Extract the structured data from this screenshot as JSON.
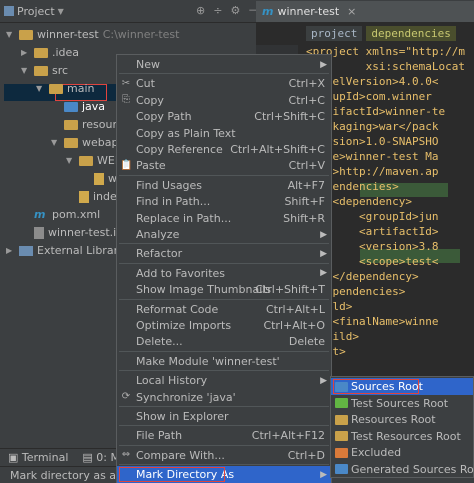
{
  "topbar": {
    "project_tab": "Project",
    "editor_tab": "winner-test"
  },
  "tree": [
    {
      "label": "winner-test",
      "extra": "C:\\winner-test",
      "indent": 0,
      "icon": "folder",
      "arrow": "▼"
    },
    {
      "label": ".idea",
      "extra": "",
      "indent": 1,
      "icon": "folder",
      "arrow": "▶"
    },
    {
      "label": "src",
      "extra": "",
      "indent": 1,
      "icon": "folder",
      "arrow": "▼"
    },
    {
      "label": "main",
      "extra": "",
      "indent": 2,
      "icon": "folder",
      "arrow": "▼"
    },
    {
      "label": "java",
      "extra": "",
      "indent": 3,
      "icon": "folder-blue",
      "arrow": ""
    },
    {
      "label": "resourc",
      "extra": "",
      "indent": 3,
      "icon": "folder",
      "arrow": ""
    },
    {
      "label": "webapp",
      "extra": "",
      "indent": 3,
      "icon": "folder-web",
      "arrow": "▼"
    },
    {
      "label": "WEB",
      "extra": "",
      "indent": 4,
      "icon": "folder",
      "arrow": "▼"
    },
    {
      "label": "w",
      "extra": "",
      "indent": 5,
      "icon": "file",
      "arrow": ""
    },
    {
      "label": "inde",
      "extra": "",
      "indent": 4,
      "icon": "file",
      "arrow": ""
    },
    {
      "label": "pom.xml",
      "extra": "",
      "indent": 1,
      "icon": "maven",
      "arrow": ""
    },
    {
      "label": "winner-test.iml",
      "extra": "",
      "indent": 1,
      "icon": "iml",
      "arrow": ""
    },
    {
      "label": "External Libraries",
      "extra": "",
      "indent": 0,
      "icon": "libs",
      "arrow": "▶"
    }
  ],
  "editor": {
    "breadcrumbs": [
      "project",
      "dependencies"
    ],
    "line_number": "1",
    "lines": [
      "<project xmlns=\"http://m",
      "         xsi:schemaLocat",
      "<modelVersion>4.0.0<",
      "<groupId>com.winner",
      "<artifactId>winner-te",
      "<packaging>war</pack",
      "<version>1.0-SNAPSHO",
      "<name>winner-test Ma",
      "<url>http://maven.ap",
      "<dependencies>",
      "    <dependency>",
      "        <groupId>jun",
      "        <artifactId>",
      "        <version>3.8",
      "        <scope>test<",
      "    </dependency>",
      "</dependencies>",
      "<build>",
      "    <finalName>winne",
      "</build>",
      "oject>"
    ]
  },
  "context_menu": [
    {
      "label": "New",
      "shortcut": "",
      "submenu": true,
      "icon": ""
    },
    {
      "sep": true
    },
    {
      "label": "Cut",
      "shortcut": "Ctrl+X",
      "icon": "scissors-icon"
    },
    {
      "label": "Copy",
      "shortcut": "Ctrl+C",
      "icon": "copy-icon"
    },
    {
      "label": "Copy Path",
      "shortcut": "Ctrl+Shift+C",
      "icon": ""
    },
    {
      "label": "Copy as Plain Text",
      "shortcut": "",
      "icon": ""
    },
    {
      "label": "Copy Reference",
      "shortcut": "Ctrl+Alt+Shift+C",
      "icon": ""
    },
    {
      "label": "Paste",
      "shortcut": "Ctrl+V",
      "icon": "paste-icon"
    },
    {
      "sep": true
    },
    {
      "label": "Find Usages",
      "shortcut": "Alt+F7",
      "icon": ""
    },
    {
      "label": "Find in Path...",
      "shortcut": "Shift+F",
      "icon": ""
    },
    {
      "label": "Replace in Path...",
      "shortcut": "Shift+R",
      "icon": ""
    },
    {
      "label": "Analyze",
      "shortcut": "",
      "submenu": true,
      "icon": ""
    },
    {
      "sep": true
    },
    {
      "label": "Refactor",
      "shortcut": "",
      "submenu": true,
      "icon": ""
    },
    {
      "sep": true
    },
    {
      "label": "Add to Favorites",
      "shortcut": "",
      "submenu": true,
      "icon": ""
    },
    {
      "label": "Show Image Thumbnails",
      "shortcut": "Ctrl+Shift+T",
      "icon": ""
    },
    {
      "sep": true
    },
    {
      "label": "Reformat Code",
      "shortcut": "Ctrl+Alt+L",
      "icon": ""
    },
    {
      "label": "Optimize Imports",
      "shortcut": "Ctrl+Alt+O",
      "icon": ""
    },
    {
      "label": "Delete...",
      "shortcut": "Delete",
      "icon": ""
    },
    {
      "sep": true
    },
    {
      "label": "Make Module 'winner-test'",
      "shortcut": "",
      "icon": ""
    },
    {
      "sep": true
    },
    {
      "label": "Local History",
      "shortcut": "",
      "submenu": true,
      "icon": ""
    },
    {
      "label": "Synchronize 'java'",
      "shortcut": "",
      "icon": "sync-icon"
    },
    {
      "sep": true
    },
    {
      "label": "Show in Explorer",
      "shortcut": "",
      "icon": ""
    },
    {
      "sep": true
    },
    {
      "label": "File Path",
      "shortcut": "Ctrl+Alt+F12",
      "icon": ""
    },
    {
      "sep": true
    },
    {
      "label": "Compare With...",
      "shortcut": "Ctrl+D",
      "icon": "compare-icon"
    },
    {
      "sep": true
    },
    {
      "label": "Mark Directory As",
      "shortcut": "",
      "submenu": true,
      "icon": "",
      "hover": true
    }
  ],
  "submenu": [
    {
      "label": "Sources Root",
      "color": "#4a88c7",
      "hover": true
    },
    {
      "label": "Test Sources Root",
      "color": "#62b543"
    },
    {
      "label": "Resources Root",
      "color": "#c9a14a"
    },
    {
      "label": "Test Resources Root",
      "color": "#c9a14a"
    },
    {
      "label": "Excluded",
      "color": "#d97a3a"
    },
    {
      "label": "Generated Sources Root",
      "color": "#4a88c7"
    }
  ],
  "bottombar": {
    "terminal": "Terminal",
    "messages": "0: Mes"
  },
  "status": "Mark directory as a sou"
}
